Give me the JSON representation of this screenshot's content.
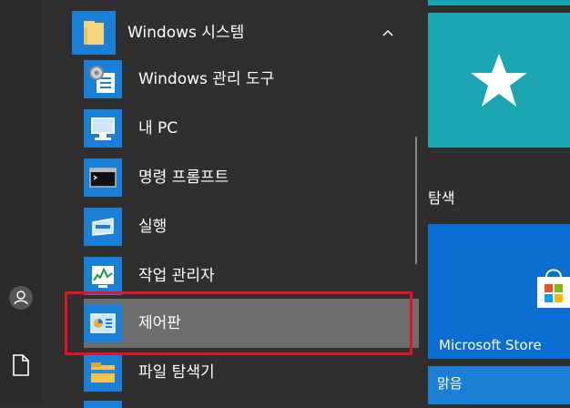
{
  "folder": {
    "label": "Windows 시스템",
    "chevron_icon": "chevron-up-icon",
    "icon": "folder-icon"
  },
  "items": [
    {
      "label": "Windows 관리 도구",
      "icon": "admin-tools-icon"
    },
    {
      "label": "내 PC",
      "icon": "computer-icon"
    },
    {
      "label": "명령 프롬프트",
      "icon": "command-prompt-icon"
    },
    {
      "label": "실행",
      "icon": "run-icon"
    },
    {
      "label": "작업 관리자",
      "icon": "task-manager-icon"
    },
    {
      "label": "제어판",
      "icon": "control-panel-icon"
    },
    {
      "label": "파일 탐색기",
      "icon": "file-explorer-icon"
    }
  ],
  "rail": {
    "user_icon": "user-icon",
    "documents_icon": "document-icon"
  },
  "tiles": {
    "group_label": "탐색",
    "favorites_icon": "star-icon",
    "store_label": "Microsoft Store",
    "weather_label": "맑음"
  },
  "colors": {
    "tile_blue": "#1a7fd6",
    "teal": "#1aa6b0",
    "highlight_red": "#e81123"
  }
}
